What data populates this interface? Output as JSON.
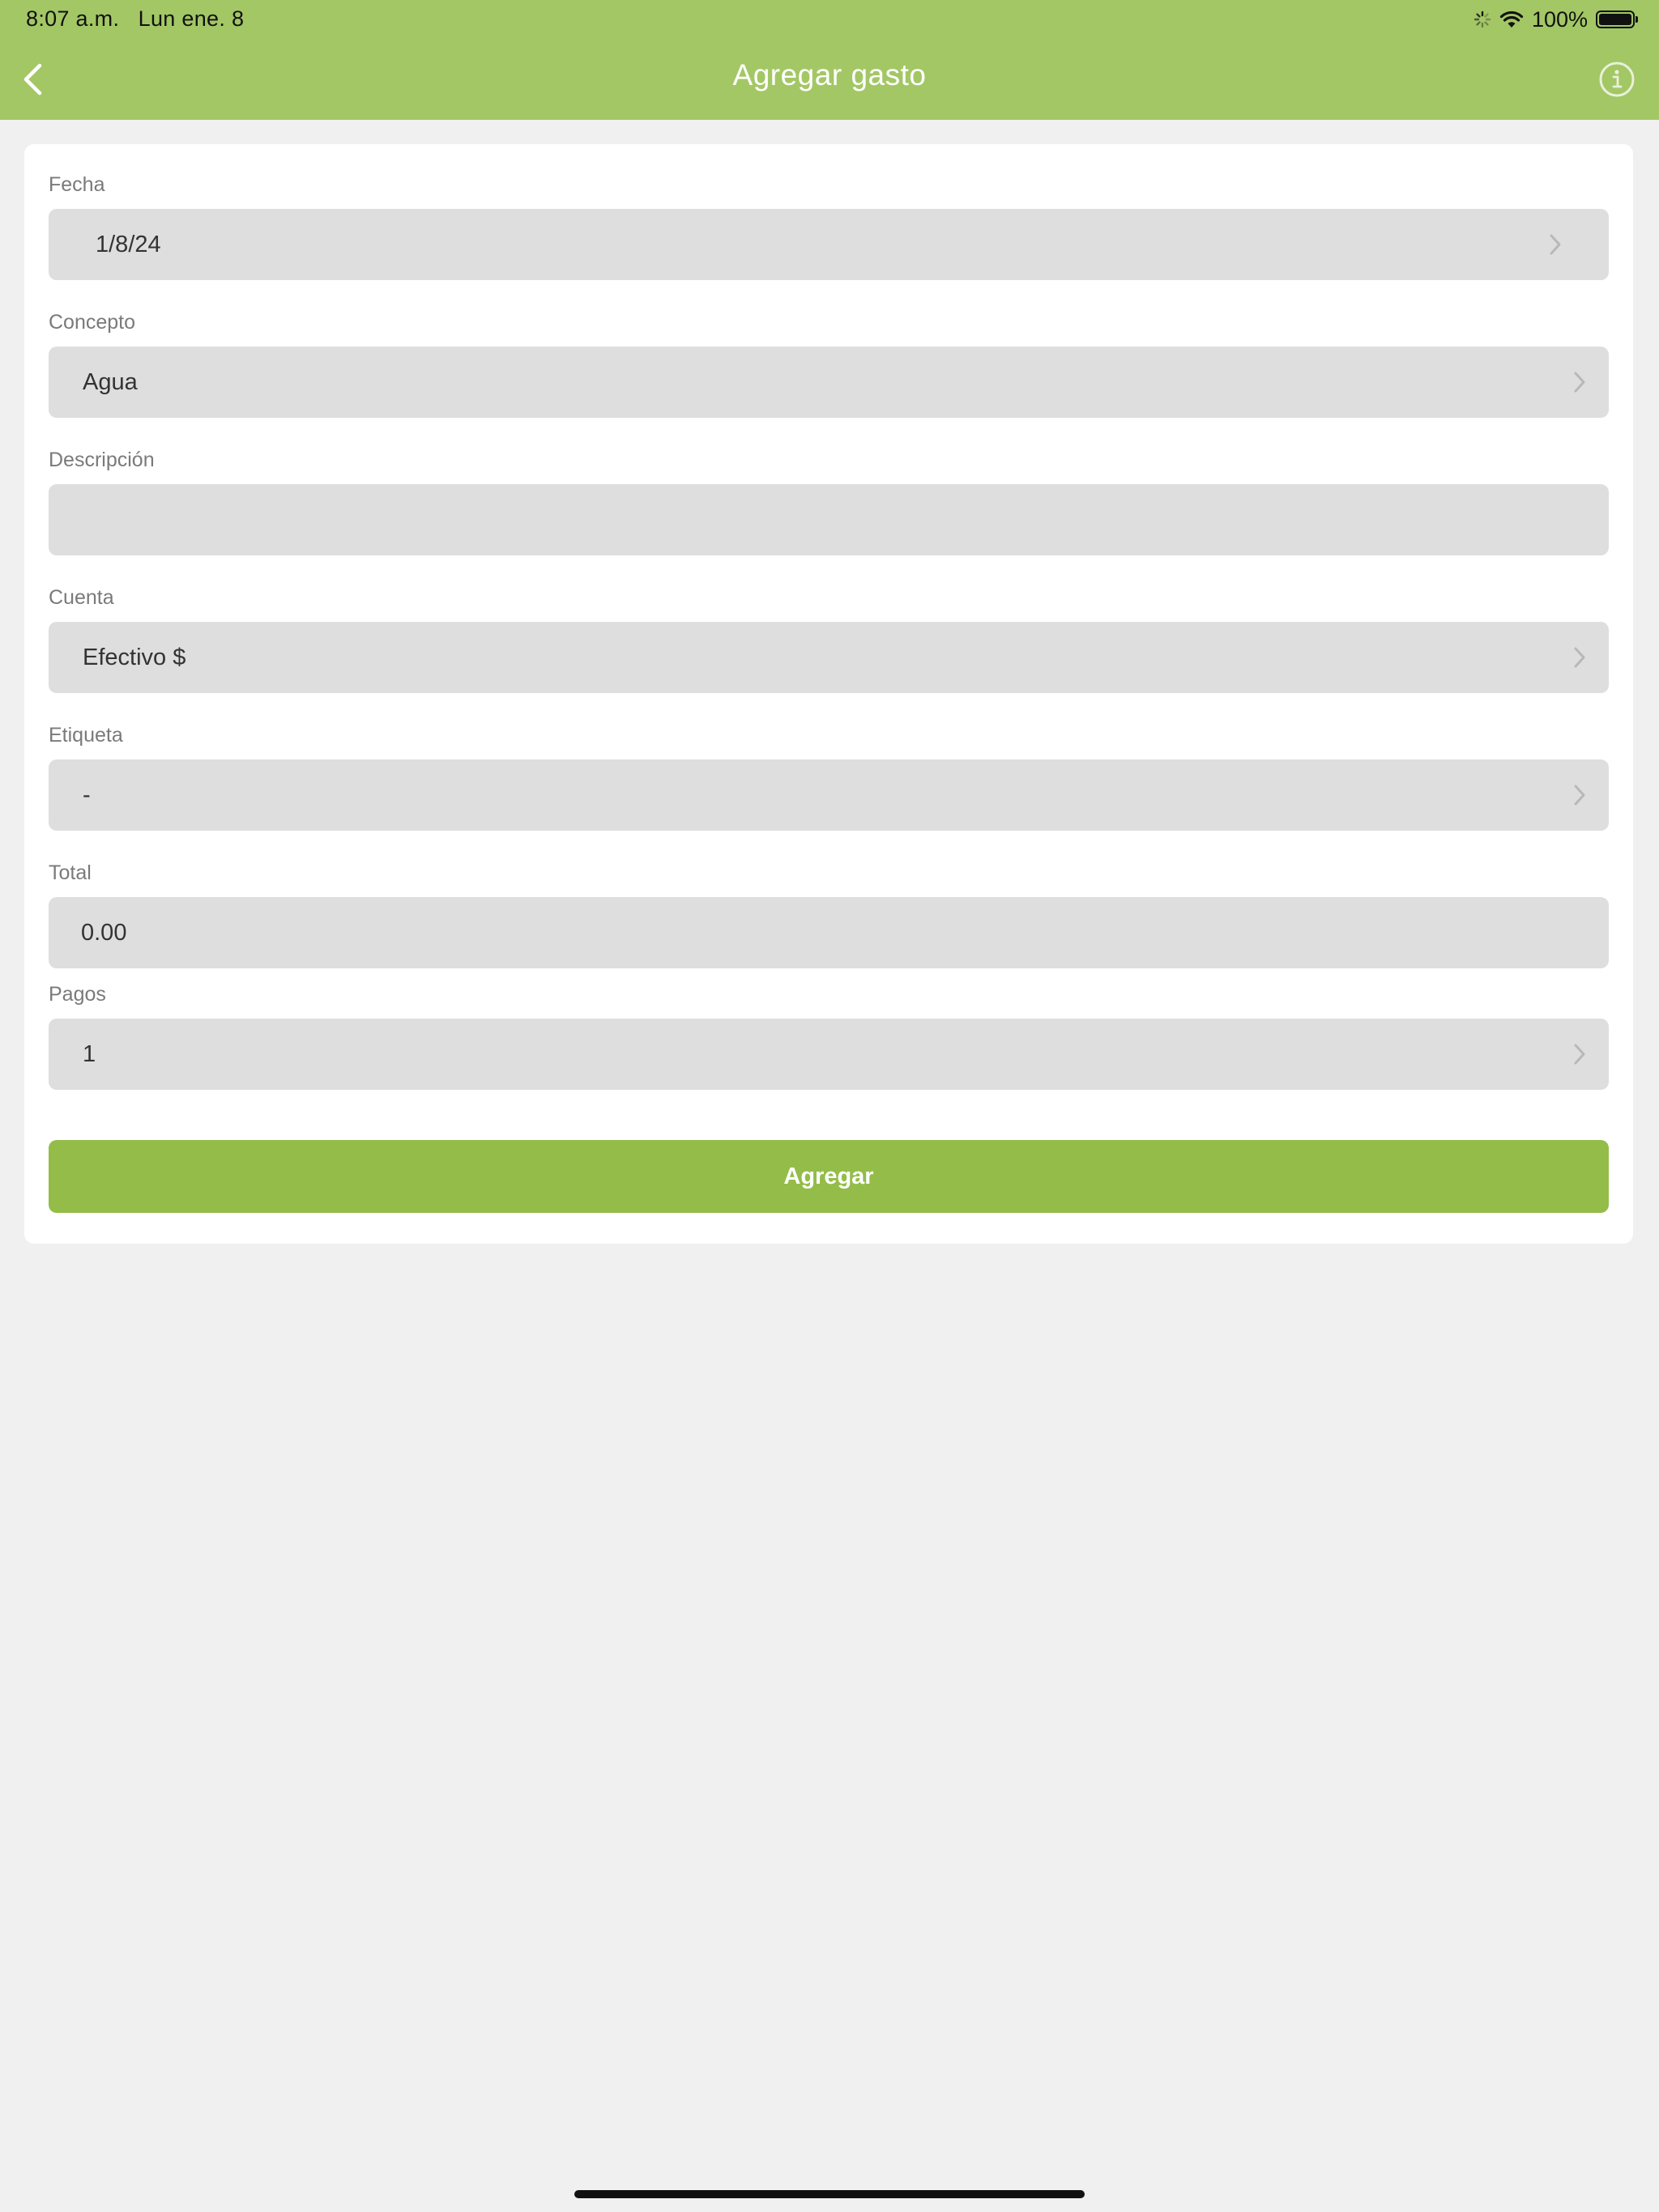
{
  "status_bar": {
    "time": "8:07 a.m.",
    "date": "Lun ene. 8",
    "battery": "100%",
    "battery_level": 1.0
  },
  "nav": {
    "title": "Agregar gasto",
    "back_icon": "chevron-left-icon",
    "info_icon": "info-circle-icon"
  },
  "form": {
    "fecha": {
      "label": "Fecha",
      "value": "1/8/24"
    },
    "concepto": {
      "label": "Concepto",
      "value": "Agua"
    },
    "descripcion": {
      "label": "Descripción",
      "value": ""
    },
    "cuenta": {
      "label": "Cuenta",
      "value": "Efectivo $"
    },
    "etiqueta": {
      "label": "Etiqueta",
      "value": "-"
    },
    "total": {
      "label": "Total",
      "value": "0.00"
    },
    "pagos": {
      "label": "Pagos",
      "value": "1"
    }
  },
  "actions": {
    "add_label": "Agregar"
  },
  "colors": {
    "header": "#a3c765",
    "button": "#93bd48",
    "field": "#dedede",
    "background": "#f0f0f0"
  }
}
